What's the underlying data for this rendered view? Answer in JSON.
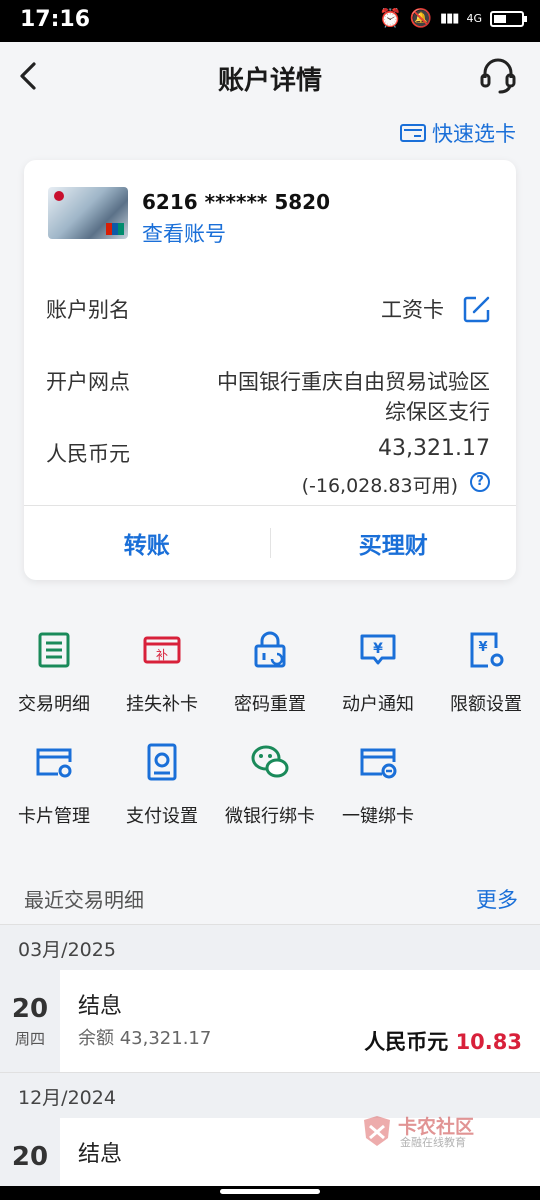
{
  "status": {
    "time": "17:16",
    "network": "4G"
  },
  "header": {
    "title": "账户详情"
  },
  "quick_select": "快速选卡",
  "card": {
    "number": "6216 ****** 5820",
    "view_number": "查看账号",
    "alias_label": "账户别名",
    "alias_value": "工资卡",
    "branch_label": "开户网点",
    "branch_line1": "中国银行重庆自由贸易试验区",
    "branch_line2": "综保区支行",
    "currency_label": "人民币元",
    "balance": "43,321.17",
    "available": "(-16,028.83可用)",
    "actions": [
      "转账",
      "买理财"
    ]
  },
  "functions": [
    {
      "label": "交易明细",
      "icon": "transaction-detail-icon",
      "color": "#1a8a5a"
    },
    {
      "label": "挂失补卡",
      "icon": "report-loss-icon",
      "color": "#d8203a"
    },
    {
      "label": "密码重置",
      "icon": "password-reset-icon",
      "color": "#1a6fd8"
    },
    {
      "label": "动户通知",
      "icon": "account-notify-icon",
      "color": "#1a6fd8"
    },
    {
      "label": "限额设置",
      "icon": "limit-settings-icon",
      "color": "#1a6fd8"
    },
    {
      "label": "卡片管理",
      "icon": "card-manage-icon",
      "color": "#1a6fd8"
    },
    {
      "label": "支付设置",
      "icon": "payment-settings-icon",
      "color": "#1a6fd8"
    },
    {
      "label": "微银行绑卡",
      "icon": "wechat-bind-icon",
      "color": "#1a8a5a"
    },
    {
      "label": "一键绑卡",
      "icon": "one-key-bind-icon",
      "color": "#1a6fd8"
    }
  ],
  "recent": {
    "title": "最近交易明细",
    "more": "更多",
    "groups": [
      {
        "month": "03月/2025",
        "day": "20",
        "weekday": "周四",
        "name": "结息",
        "balance": "余额 43,321.17",
        "currency": "人民币元",
        "amount": "10.83"
      },
      {
        "month": "12月/2024",
        "day": "20",
        "weekday": "",
        "name": "结息",
        "balance": "",
        "currency": "",
        "amount": ""
      }
    ]
  },
  "watermark": {
    "title": "卡农社区",
    "subtitle": "金融在线教育"
  },
  "colors": {
    "accent": "#1a6fd8",
    "amount_red": "#d8203a",
    "green": "#1a8a5a"
  }
}
